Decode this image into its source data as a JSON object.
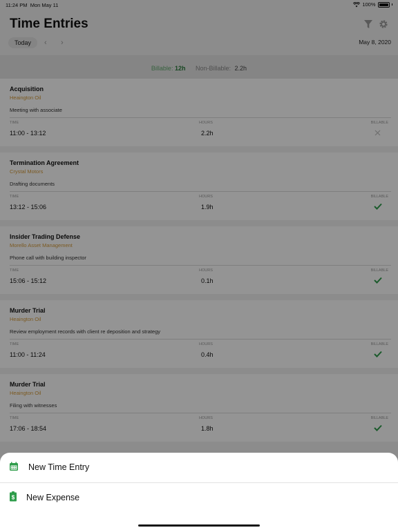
{
  "status_bar": {
    "time": "11:24 PM",
    "date": "Mon May 11",
    "battery": "100%"
  },
  "header": {
    "title": "Time Entries",
    "today_label": "Today",
    "date": "May 8, 2020"
  },
  "summary": {
    "billable_label": "Billable:",
    "billable_value": "12h",
    "non_billable_label": "Non-Billable:",
    "non_billable_value": "2.2h"
  },
  "column_labels": {
    "time": "TIME",
    "hours": "HOURS",
    "billable": "BILLABLE"
  },
  "entries": [
    {
      "matter": "Acquisition",
      "client": "Heaington Oil",
      "description": "Meeting with associate",
      "time": "11:00 - 13:12",
      "hours": "2.2h",
      "billable": false
    },
    {
      "matter": "Termination Agreement",
      "client": "Crystal Motors",
      "description": "Drafting documents",
      "time": "13:12 - 15:06",
      "hours": "1.9h",
      "billable": true
    },
    {
      "matter": "Insider Trading Defense",
      "client": "Morello Asset Management",
      "description": "Phone call with building inspector",
      "time": "15:06 - 15:12",
      "hours": "0.1h",
      "billable": true
    },
    {
      "matter": "Murder Trial",
      "client": "Heaington Oil",
      "description": "Review employment records with client re deposition and strategy",
      "time": "11:00 - 11:24",
      "hours": "0.4h",
      "billable": true
    },
    {
      "matter": "Murder Trial",
      "client": "Heaington Oil",
      "description": "Filing with witnesses",
      "time": "17:06 - 18:54",
      "hours": "1.8h",
      "billable": true
    }
  ],
  "action_sheet": {
    "new_time_entry": "New Time Entry",
    "new_expense": "New Expense"
  },
  "colors": {
    "accent_green": "#2e9c4a",
    "client_orange": "#d49a3a"
  },
  "icons": {
    "filter": "filter-icon",
    "settings": "gear-icon",
    "prev": "chevron-left-icon",
    "next": "chevron-right-icon",
    "calendar": "calendar-icon",
    "receipt": "receipt-icon"
  }
}
